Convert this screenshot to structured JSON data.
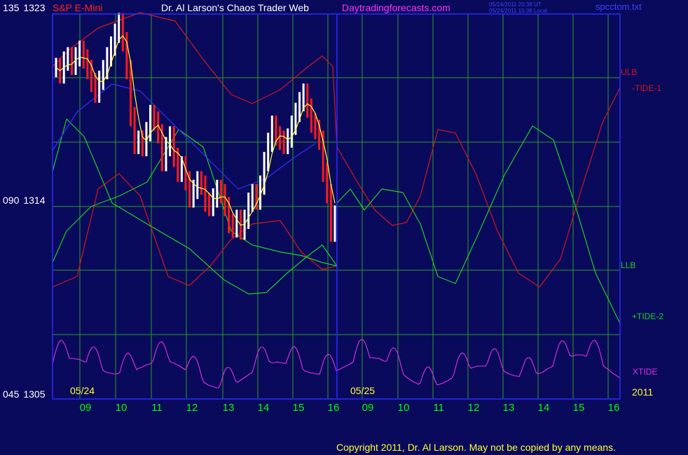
{
  "header": {
    "symbol": "S&P E-Mini",
    "title": "Dr. Al Larson's Chaos Trader Web",
    "site": "Daytradingforecasts.com",
    "stamp_utc": "05/24/2011 20:38 UT",
    "stamp_local": "05/24/2011 15:38 Local",
    "file": "spcctom.txt"
  },
  "copyright": "Copyright 2011, Dr. Al Larson. May not be copied by any means.",
  "colors": {
    "background": "#0a0a5c",
    "grid": "#2e9a2e",
    "frame": "#2a2aff",
    "price_up": "#ffffff",
    "price_down": "#ff1a1a",
    "ulb": "#d01818",
    "llb": "#1fd01f",
    "tide1": "#d01818",
    "tide2": "#1fd01f",
    "xtide": "#e030e0",
    "moving_avg_yellow": "#ffff40",
    "moving_avg_blue": "#3030ff"
  },
  "chart_data": {
    "type": "line",
    "title": "S&P E-Mini",
    "ylim": [
      1305,
      1323
    ],
    "y_ticks": [
      {
        "value": 1323,
        "cycle": "135",
        "price": "1323"
      },
      {
        "value": 1314,
        "cycle": "090",
        "price": "1314"
      },
      {
        "value": 1305,
        "cycle": "045",
        "price": "1305"
      }
    ],
    "x_tick_labels": [
      "09",
      "10",
      "11",
      "12",
      "13",
      "14",
      "15",
      "16",
      "09",
      "10",
      "11",
      "12",
      "13",
      "14",
      "15",
      "16"
    ],
    "date_labels": [
      "05/24",
      "05/25"
    ],
    "year_label": "2011",
    "series": [
      {
        "name": "ULB"
      },
      {
        "name": "-TIDE-1"
      },
      {
        "name": "LLB"
      },
      {
        "name": "+TIDE-2"
      },
      {
        "name": "XTIDE"
      }
    ],
    "price_bars_close": [
      1320.5,
      1320.2,
      1320.8,
      1321.0,
      1320.6,
      1321.0,
      1321.3,
      1320.9,
      1320.4,
      1319.8,
      1319.3,
      1319.9,
      1320.4,
      1321.0,
      1321.5,
      1322.1,
      1322.6,
      1321.7,
      1320.4,
      1318.2,
      1316.9,
      1317.1,
      1316.8,
      1317.5,
      1318.3,
      1318.0,
      1317.4,
      1316.1,
      1316.8,
      1317.3,
      1316.3,
      1315.6,
      1315.9,
      1315.2,
      1314.4,
      1314.8,
      1315.2,
      1315.0,
      1314.2,
      1314.0,
      1314.4,
      1314.8,
      1314.6,
      1314.0,
      1313.2,
      1313.0,
      1313.4,
      1312.9,
      1313.4,
      1314.2,
      1314.6,
      1314.3,
      1315.0,
      1316.1,
      1317.0,
      1317.8,
      1317.3,
      1317.1,
      1316.9,
      1317.2,
      1317.8,
      1318.4,
      1318.9,
      1319.3,
      1318.6,
      1317.9,
      1317.6,
      1317.1,
      1315.6,
      1314.6,
      1312.8,
      1313.6
    ]
  }
}
